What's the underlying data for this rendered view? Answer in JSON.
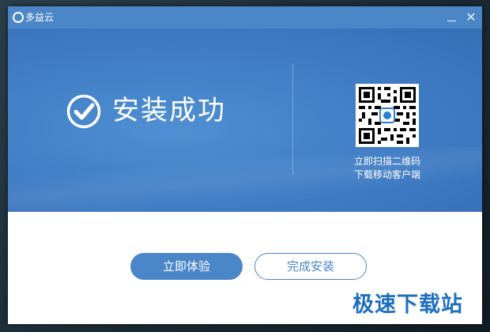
{
  "window": {
    "title": "多益云",
    "minimize_icon": "minimize-icon",
    "close_label": "✕"
  },
  "banner": {
    "success_text": "安装成功",
    "success_icon": "check-circle-icon",
    "qr_caption_line1": "立即扫描二维码",
    "qr_caption_line2": "下载移动客户端"
  },
  "actions": {
    "experience_label": "立即体验",
    "finish_label": "完成安装"
  },
  "watermark": {
    "text": "极速下载站"
  },
  "colors": {
    "accent": "#4a86c8",
    "banner": "#3f7cc4",
    "watermark": "#1e6fbf"
  }
}
